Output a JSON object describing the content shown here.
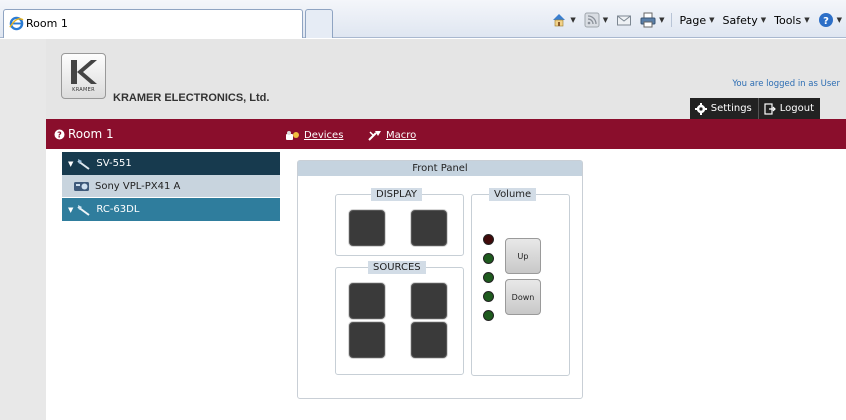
{
  "browser": {
    "tab_title": "Room 1",
    "commands": {
      "page": "Page",
      "safety": "Safety",
      "tools": "Tools"
    }
  },
  "header": {
    "brand": "KRAMER ELECTRONICS, Ltd.",
    "logo_small": "KRAMER",
    "login_status": "You are logged in as User",
    "settings_label": "Settings",
    "logout_label": "Logout"
  },
  "room_bar": {
    "title": "Room 1",
    "devices_label": "Devices",
    "macro_label": "Macro"
  },
  "tree": {
    "items": [
      {
        "label": "SV-551",
        "style": "dark"
      },
      {
        "label": "Sony VPL-PX41 A",
        "style": "light"
      },
      {
        "label": "RC-63DL",
        "style": "mid"
      }
    ]
  },
  "panel": {
    "title": "Front Panel",
    "display_legend": "DISPLAY",
    "sources_legend": "SOURCES",
    "volume_legend": "Volume",
    "up_label": "Up",
    "down_label": "Down"
  },
  "colors": {
    "accent_crimson": "#8a0e2c",
    "tree_dark": "#173a4e",
    "tree_mid": "#2f7d9d",
    "led_off": "#3f0a0a",
    "led_green": "#1e5a1e"
  }
}
